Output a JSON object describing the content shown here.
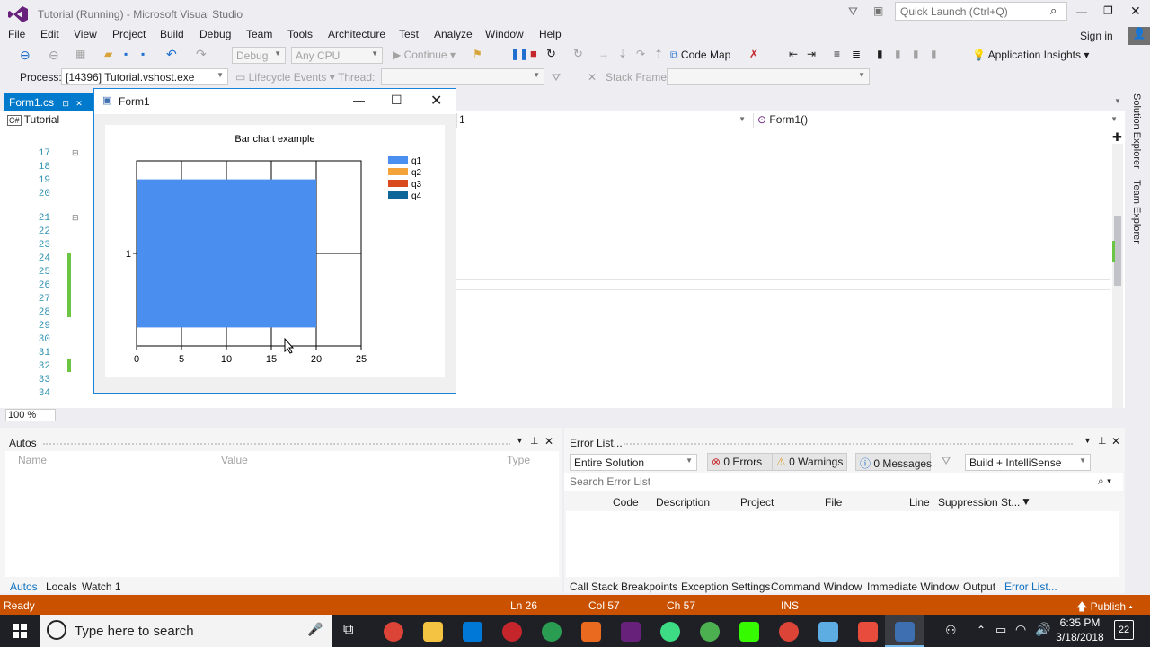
{
  "window": {
    "title": "Tutorial (Running) - Microsoft Visual Studio",
    "quick_launch": "Quick Launch (Ctrl+Q)",
    "sign_in": "Sign in"
  },
  "menu": [
    "File",
    "Edit",
    "View",
    "Project",
    "Build",
    "Debug",
    "Team",
    "Tools",
    "Architecture",
    "Test",
    "Analyze",
    "Window",
    "Help"
  ],
  "toolbar": {
    "config": "Debug",
    "platform": "Any CPU",
    "continue": "Continue",
    "code_map": "Code Map",
    "app_insights": "Application Insights"
  },
  "debug_bar": {
    "process_label": "Process:",
    "process_value": "[14396] Tutorial.vshost.exe",
    "lifecycle": "Lifecycle Events",
    "thread_label": "Thread:",
    "stack_label": "Stack Frame:"
  },
  "editor": {
    "tab_name": "Form1.cs",
    "nav_project": "Tutorial",
    "nav_class_fragment": "1",
    "nav_member": "Form1()",
    "zoom": "100 %",
    "line_numbers": [
      "17",
      "18",
      "19",
      "20",
      "21",
      "22",
      "23",
      "24",
      "25",
      "26",
      "27",
      "28",
      "29",
      "30",
      "31",
      "32",
      "33",
      "34"
    ]
  },
  "side_panels": {
    "solution_explorer": "Solution Explorer",
    "team_explorer": "Team Explorer"
  },
  "form": {
    "title": "Form1"
  },
  "chart_data": {
    "type": "bar",
    "orientation": "horizontal",
    "title": "Bar chart example",
    "categories": [
      "1"
    ],
    "series": [
      {
        "name": "q1",
        "values": [
          20
        ],
        "color": "#4a8ff0"
      },
      {
        "name": "q2",
        "values": [
          0
        ],
        "color": "#f3a33a"
      },
      {
        "name": "q3",
        "values": [
          0
        ],
        "color": "#d94a1e"
      },
      {
        "name": "q4",
        "values": [
          0
        ],
        "color": "#0e6698"
      }
    ],
    "xlim": [
      0,
      25
    ],
    "x_ticks": [
      "0",
      "5",
      "10",
      "15",
      "20",
      "25"
    ],
    "grid": true,
    "legend_position": "top-right"
  },
  "autos": {
    "title": "Autos",
    "col_name": "Name",
    "col_value": "Value",
    "col_type": "Type",
    "tabs": [
      "Autos",
      "Locals",
      "Watch 1"
    ]
  },
  "errors": {
    "title": "Error List...",
    "scope": "Entire Solution",
    "errors": "0 Errors",
    "warnings": "0 Warnings",
    "messages": "0 Messages",
    "build_filter": "Build + IntelliSense",
    "search": "Search Error List",
    "columns": [
      "Code",
      "Description",
      "Project",
      "File",
      "Line",
      "Suppression St..."
    ],
    "tabs": [
      "Call Stack",
      "Breakpoints",
      "Exception Settings",
      "Command Window",
      "Immediate Window",
      "Output",
      "Error List..."
    ]
  },
  "status": {
    "ready": "Ready",
    "ln": "Ln 26",
    "col": "Col 57",
    "ch": "Ch 57",
    "ins": "INS",
    "publish": "Publish"
  },
  "taskbar": {
    "search": "Type here to search",
    "time": "6:35 PM",
    "date": "3/18/2018",
    "notifications": "22"
  }
}
